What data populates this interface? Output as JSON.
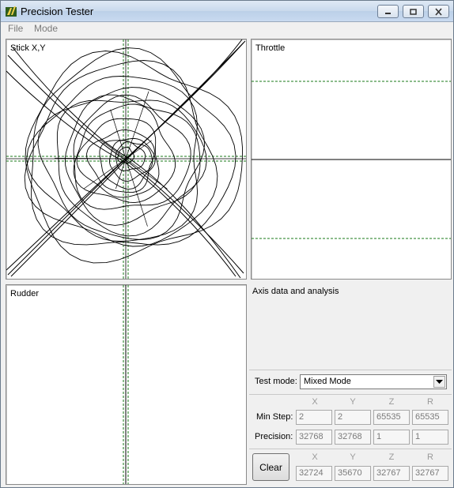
{
  "window": {
    "title": "Precision Tester"
  },
  "menu": [
    "File",
    "Mode"
  ],
  "panels": {
    "stick": {
      "label": "Stick X,Y"
    },
    "throttle": {
      "label": "Throttle"
    },
    "rudder": {
      "label": "Rudder"
    }
  },
  "analysis": {
    "title": "Axis data and analysis"
  },
  "test_mode": {
    "label": "Test mode:",
    "value": "Mixed Mode"
  },
  "axes": [
    "X",
    "Y",
    "Z",
    "R"
  ],
  "min_step": {
    "label": "Min Step:",
    "values": [
      "2",
      "2",
      "65535",
      "65535"
    ]
  },
  "precision": {
    "label": "Precision:",
    "values": [
      "32768",
      "32768",
      "1",
      "1"
    ]
  },
  "clear": {
    "label": "Clear",
    "values": [
      "32724",
      "35670",
      "32767",
      "32767"
    ]
  },
  "colors": {
    "guide": "#1a7a1a",
    "trace": "#000000"
  }
}
